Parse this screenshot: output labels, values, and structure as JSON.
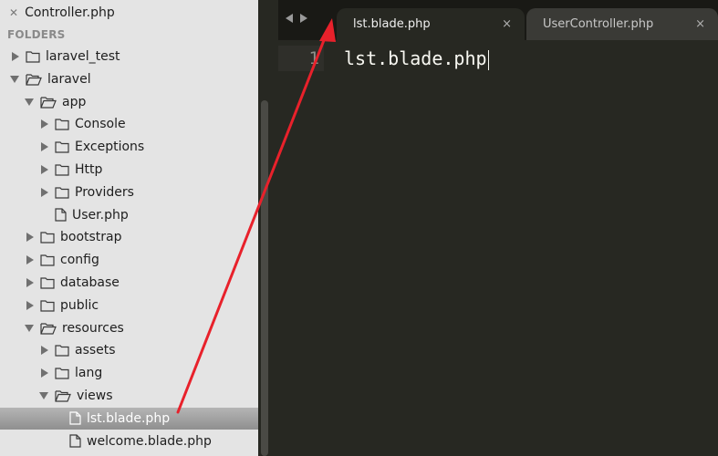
{
  "sidebar": {
    "open_file": "Controller.php",
    "folders_header": "FOLDERS",
    "tree": [
      {
        "label": "laravel_test",
        "type": "folder",
        "state": "collapsed",
        "depth": 0
      },
      {
        "label": "laravel",
        "type": "folder",
        "state": "expanded",
        "depth": 0
      },
      {
        "label": "app",
        "type": "folder",
        "state": "expanded",
        "depth": 1
      },
      {
        "label": "Console",
        "type": "folder",
        "state": "collapsed",
        "depth": 2
      },
      {
        "label": "Exceptions",
        "type": "folder",
        "state": "collapsed",
        "depth": 2
      },
      {
        "label": "Http",
        "type": "folder",
        "state": "collapsed",
        "depth": 2
      },
      {
        "label": "Providers",
        "type": "folder",
        "state": "collapsed",
        "depth": 2
      },
      {
        "label": "User.php",
        "type": "file",
        "state": "none",
        "depth": 2
      },
      {
        "label": "bootstrap",
        "type": "folder",
        "state": "collapsed",
        "depth": 1
      },
      {
        "label": "config",
        "type": "folder",
        "state": "collapsed",
        "depth": 1
      },
      {
        "label": "database",
        "type": "folder",
        "state": "collapsed",
        "depth": 1
      },
      {
        "label": "public",
        "type": "folder",
        "state": "collapsed",
        "depth": 1
      },
      {
        "label": "resources",
        "type": "folder",
        "state": "expanded",
        "depth": 1
      },
      {
        "label": "assets",
        "type": "folder",
        "state": "collapsed",
        "depth": 2
      },
      {
        "label": "lang",
        "type": "folder",
        "state": "collapsed",
        "depth": 2
      },
      {
        "label": "views",
        "type": "folder",
        "state": "expanded",
        "depth": 2
      },
      {
        "label": "lst.blade.php",
        "type": "file",
        "state": "none",
        "depth": 3,
        "selected": true
      },
      {
        "label": "welcome.blade.php",
        "type": "file",
        "state": "none",
        "depth": 3
      }
    ]
  },
  "tabs": [
    {
      "label": "lst.blade.php",
      "active": true,
      "close": "×"
    },
    {
      "label": "UserController.php",
      "active": false,
      "close": "×"
    }
  ],
  "editor": {
    "line_number": "1",
    "line_text": "lst.blade.php"
  },
  "colors": {
    "sidebar_bg": "#e4e4e4",
    "editor_bg": "#272822",
    "annotation_arrow": "#e8212b"
  }
}
